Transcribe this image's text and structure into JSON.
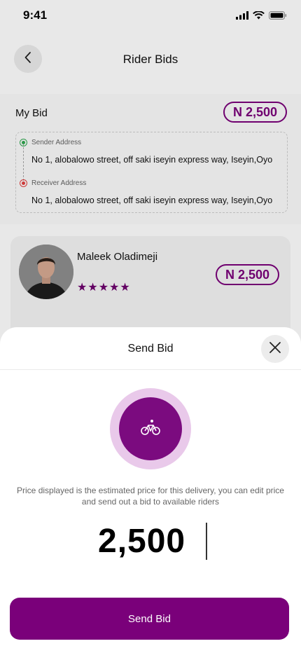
{
  "status_bar": {
    "time": "9:41"
  },
  "header": {
    "title": "Rider Bids"
  },
  "my_bid": {
    "label": "My Bid",
    "price": "N 2,500",
    "sender_label": "Sender Address",
    "sender_address": "No 1, alobalowo street, off saki iseyin express way, Iseyin,Oyo",
    "receiver_label": "Receiver Address",
    "receiver_address": "No 1, alobalowo street, off saki iseyin express way, Iseyin,Oyo"
  },
  "rider": {
    "name": "Maleek Oladimeji",
    "stars": "★★★★★",
    "rating": 5,
    "price": "N 2,500"
  },
  "sheet": {
    "title": "Send Bid",
    "description": "Price displayed is the estimated price for this delivery, you can edit price and send out a bid to available riders",
    "amount": "2,500",
    "button_label": "Send Bid"
  },
  "colors": {
    "accent": "#7a007a",
    "ring": "#e9c9ea",
    "sender": "#2fa84f",
    "receiver": "#e2403f"
  },
  "icons": {
    "back": "chevron-left-icon",
    "close": "close-icon",
    "bike": "bicycle-icon"
  }
}
